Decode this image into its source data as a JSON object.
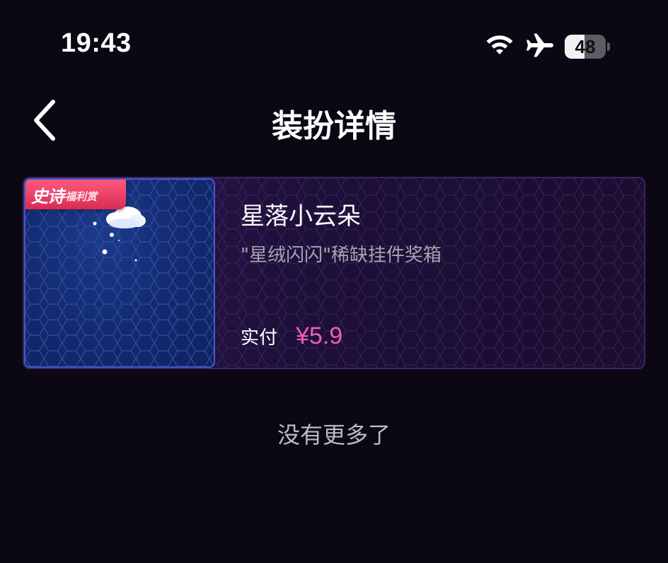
{
  "status_bar": {
    "time": "19:43",
    "battery_level": "48",
    "battery_percent": 48,
    "icons": [
      "wifi-icon",
      "airplane-icon",
      "battery-icon"
    ]
  },
  "header": {
    "title": "装扮详情",
    "back_icon": "chevron-left-icon"
  },
  "item": {
    "badge_main": "史诗",
    "badge_sub": "福利赏",
    "name": "星落小云朵",
    "description": "\"星绒闪闪\"稀缺挂件奖箱",
    "price_label": "实付",
    "price": "¥5.9",
    "thumbnail_icon": "cloud-icon"
  },
  "footer": {
    "end_text": "没有更多了"
  },
  "colors": {
    "background": "#0b0813",
    "price_accent": "#f05ab8",
    "badge": "#e0335c",
    "thumb_border": "#4a56c8"
  }
}
